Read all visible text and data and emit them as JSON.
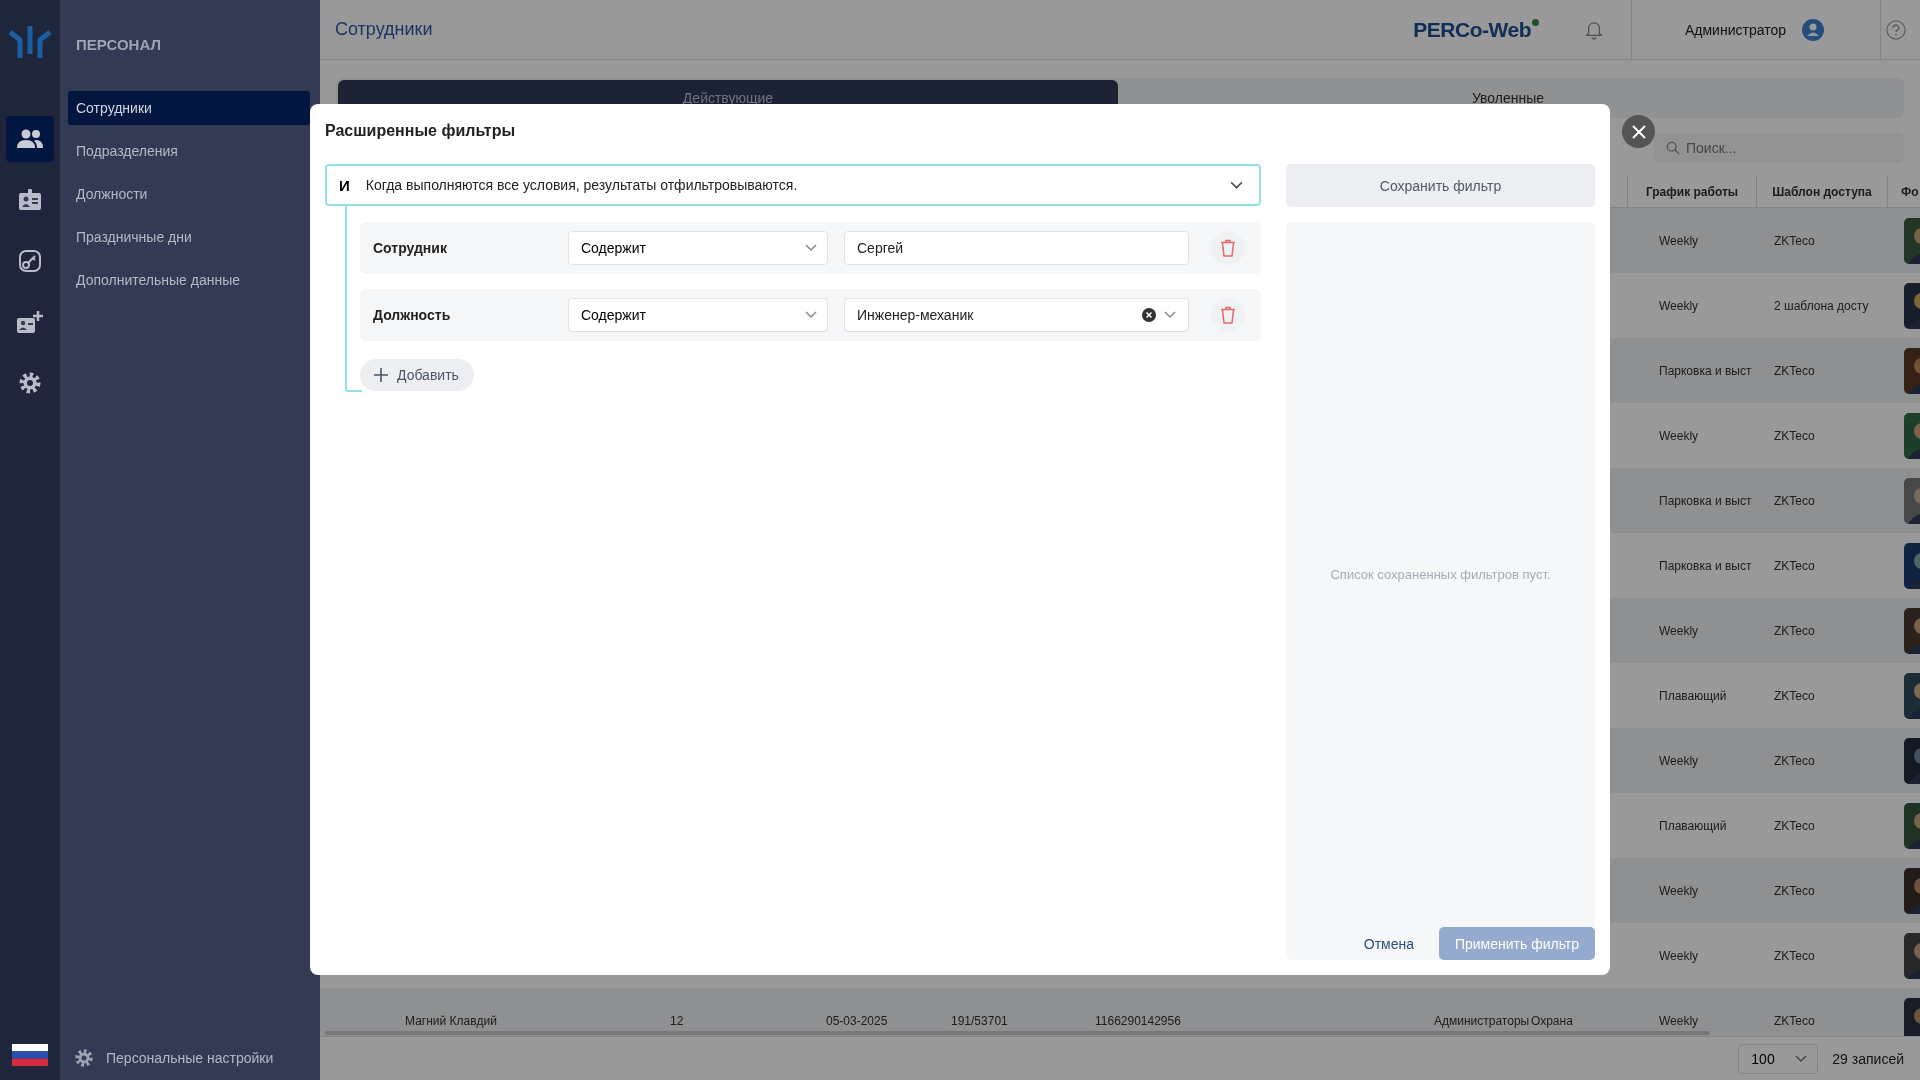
{
  "rail": {
    "items": [
      {
        "kind": "people",
        "selected": true
      },
      {
        "kind": "badge",
        "selected": false
      },
      {
        "kind": "key",
        "selected": false
      },
      {
        "kind": "badge-add",
        "selected": false
      },
      {
        "kind": "settings",
        "selected": false
      }
    ]
  },
  "sidebar": {
    "title": "ПЕРСОНАЛ",
    "items": [
      {
        "label": "Сотрудники",
        "selected": true
      },
      {
        "label": "Подразделения",
        "selected": false
      },
      {
        "label": "Должности",
        "selected": false
      },
      {
        "label": "Праздничные дни",
        "selected": false
      },
      {
        "label": "Дополнительные данные",
        "selected": false
      }
    ],
    "footer": "Персональные настройки"
  },
  "header": {
    "title": "Сотрудники",
    "brand": "PERCo-Web",
    "user": "Администратор"
  },
  "tabs": [
    {
      "label": "Действующие",
      "selected": true
    },
    {
      "label": "Уволенные",
      "selected": false
    }
  ],
  "search": {
    "placeholder": "Поиск..."
  },
  "table": {
    "columns": [
      {
        "label": "График работы"
      },
      {
        "label": "Шаблон доступа"
      },
      {
        "label": "Фо"
      }
    ],
    "rows": [
      {
        "schedule": "Weekly",
        "template": "ZKTeco"
      },
      {
        "schedule": "Weekly",
        "template": "2 шаблона досту"
      },
      {
        "schedule": "Парковка и выст",
        "template": "ZKTeco"
      },
      {
        "schedule": "Weekly",
        "template": "ZKTeco"
      },
      {
        "schedule": "Парковка и выст",
        "template": "ZKTeco"
      },
      {
        "schedule": "Парковка и выст",
        "template": "ZKTeco"
      },
      {
        "schedule": "Weekly",
        "template": "ZKTeco"
      },
      {
        "schedule": "Плавающий",
        "template": "ZKTeco"
      },
      {
        "schedule": "Weekly",
        "template": "ZKTeco"
      },
      {
        "schedule": "Плавающий",
        "template": "ZKTeco"
      },
      {
        "schedule": "Weekly",
        "template": "ZKTeco"
      },
      {
        "schedule": "Weekly",
        "template": "ZKTeco"
      },
      {
        "name": "Магний Клавдий",
        "tab_no": "12",
        "date": "05-03-2025",
        "card": "191/53701",
        "id": "1166290142956",
        "division": "Администраторы",
        "position": "Охрана",
        "schedule": "Weekly",
        "template": "ZKTeco"
      }
    ]
  },
  "pagination": {
    "page_size": "100",
    "total": "29 записей"
  },
  "modal": {
    "title": "Расширенные фильтры",
    "group": {
      "operator": "И",
      "description": "Когда выполняются все условия, результаты отфильтровываются."
    },
    "conditions": [
      {
        "kind": "text",
        "field": "Сотрудник",
        "operator": "Содержит",
        "value": "Сергей"
      },
      {
        "kind": "select",
        "field": "Должность",
        "operator": "Содержит",
        "value": "Инженер-механик"
      }
    ],
    "add_label": "Добавить",
    "save_label": "Сохранить фильтр",
    "empty_text": "Список сохраненных фильтров пуст.",
    "cancel_label": "Отмена",
    "apply": {
      "label": "Применить фильтр",
      "disabled": true
    }
  }
}
